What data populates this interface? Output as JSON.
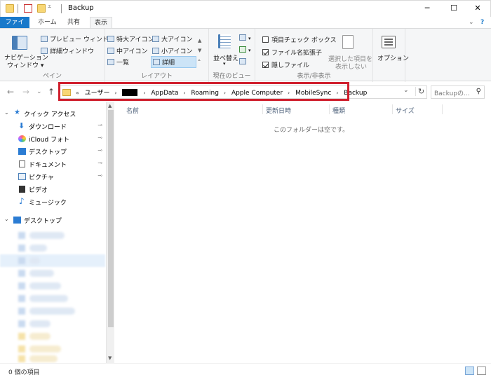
{
  "window": {
    "title": "Backup",
    "minimize_glyph": "─",
    "maximize_glyph": "☐",
    "close_glyph": "✕"
  },
  "ribbon_tabs": {
    "file": "ファイル",
    "home": "ホーム",
    "share": "共有",
    "view": "表示"
  },
  "ribbon": {
    "pane_group": {
      "nav_pane_line1": "ナビゲーション",
      "nav_pane_line2": "ウィンドウ ▾",
      "preview_pane": "プレビュー ウィンドウ",
      "details_pane": "詳細ウィンドウ",
      "label": "ペイン"
    },
    "layout_group": {
      "extra_large_icons": "特大アイコン",
      "large_icons": "大アイコン",
      "medium_icons": "中アイコン",
      "small_icons": "小アイコン",
      "list": "一覧",
      "details": "詳細",
      "label": "レイアウト"
    },
    "current_view_group": {
      "sort_by": "並べ替え",
      "label": "現在のビュー"
    },
    "show_hide_group": {
      "item_checkboxes": "項目チェック ボックス",
      "file_extensions": "ファイル名拡張子",
      "hidden_items": "隠しファイル",
      "hide_selected_line1": "選択した項目を",
      "hide_selected_line2": "表示しない",
      "label": "表示/非表示",
      "checkbox_states": {
        "item_checkboxes": false,
        "file_extensions": true,
        "hidden_items": true
      }
    },
    "options": "オプション"
  },
  "address_bar": {
    "overflow": "«",
    "crumbs": [
      "ユーザー",
      "AppData",
      "Roaming",
      "Apple Computer",
      "MobileSync",
      "Backup"
    ],
    "separator": "›",
    "refresh_glyph": "↻",
    "dropdown_glyph": "⌄"
  },
  "search": {
    "placeholder": "Backupの..."
  },
  "nav_buttons": {
    "back": "←",
    "forward": "→",
    "recent": "⌄",
    "up": "↑"
  },
  "nav_pane": {
    "quick_access": "クイック アクセス",
    "items": [
      {
        "label": "ダウンロード",
        "pinned": true
      },
      {
        "label": "iCloud フォト",
        "pinned": true
      },
      {
        "label": "デスクトップ",
        "pinned": true
      },
      {
        "label": "ドキュメント",
        "pinned": true
      },
      {
        "label": "ピクチャ",
        "pinned": true
      },
      {
        "label": "ビデオ",
        "pinned": false
      },
      {
        "label": "ミュージック",
        "pinned": false
      }
    ],
    "desktop": "デスクトップ",
    "pin_glyph": "📌"
  },
  "content": {
    "columns": [
      "名前",
      "更新日時",
      "種類",
      "サイズ"
    ],
    "empty_message": "このフォルダーは空です。"
  },
  "status_bar": {
    "item_count": "0 個の項目"
  },
  "colors": {
    "file_tab": "#1979ca",
    "highlight_border": "#d0202e",
    "folder": "#f8d775"
  }
}
